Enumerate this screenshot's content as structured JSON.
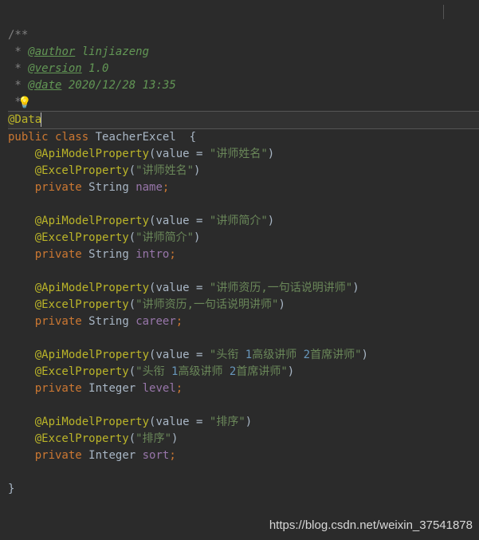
{
  "doc": {
    "open": "/**",
    "author_tag": "@author",
    "author_val": " linjiazeng",
    "version_tag": "@version",
    "version_val": " 1.0",
    "date_tag": "@date",
    "date_val": " 2020/12/28 13:35",
    "close": " */"
  },
  "annotations": {
    "data": "@Data",
    "apiModel": "@ApiModelProperty",
    "excel": "@ExcelProperty"
  },
  "kw": {
    "public": "public",
    "class": "class",
    "private": "private"
  },
  "className": "TeacherExcel",
  "valueParam": "value",
  "types": {
    "string": "String",
    "integer": "Integer"
  },
  "fields": {
    "name": {
      "api": "讲师姓名",
      "excel": "讲师姓名",
      "field": "name"
    },
    "intro": {
      "api": "讲师简介",
      "excel": "讲师简介",
      "field": "intro"
    },
    "career": {
      "api": "讲师资历,一句话说明讲师",
      "excel": "讲师资历,一句话说明讲师",
      "field": "career"
    },
    "level": {
      "api": "头衔 1高级讲师 2首席讲师",
      "excel": "头衔 1高级讲师 2首席讲师",
      "field": "level",
      "n1": "1",
      "n2": "2"
    },
    "sort": {
      "api": "排序",
      "excel": "排序",
      "field": "sort"
    }
  },
  "watermark": "https://blog.csdn.net/weixin_37541878",
  "bulb": "💡"
}
